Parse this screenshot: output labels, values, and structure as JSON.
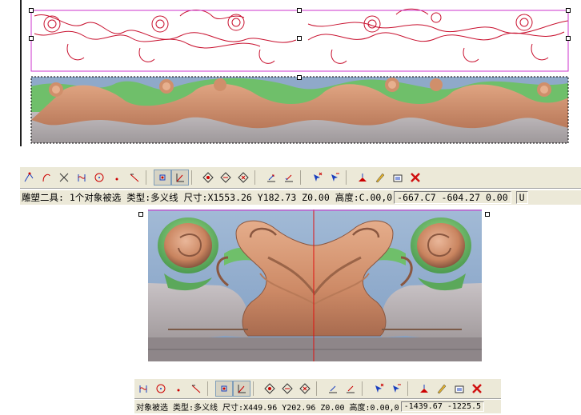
{
  "colors": {
    "vector_line": "#c8102e",
    "selection_box": "#cc33cc",
    "relief_bg": "#8fa9c9",
    "relief_wood": "#d08f6b",
    "relief_green": "#6fbf6a",
    "relief_gray": "#b5aeb1",
    "toolbar_bg": "#ece9d8"
  },
  "toolbar_top": {
    "buttons": [
      "node-edit-icon",
      "curve-icon",
      "cut-icon",
      "bezier-icon",
      "circle-icon",
      "point-icon",
      "knife-icon",
      "snap-grid-icon",
      "snap-angle-icon",
      "rotate-icon",
      "mirror-icon",
      "array-icon",
      "align-left-icon",
      "align-right-icon",
      "pick-add-icon",
      "pick-remove-icon",
      "transform-icon",
      "edit-icon",
      "properties-icon",
      "delete-icon"
    ]
  },
  "status_top": {
    "message": "雕塑二具: 1个对象被选 类型:多义线 尺寸:X1553.26 Y182.73 Z0.00 高度:C.00,0",
    "coords": "-667.C7 -604.27 0.00",
    "extra": "U"
  },
  "status_bottom": {
    "message": "对象被选 类型:多义线 尺寸:X449.96 Y202.96 Z0.00 高度:0.00,0",
    "coords": "-1439.67 -1225.5"
  }
}
